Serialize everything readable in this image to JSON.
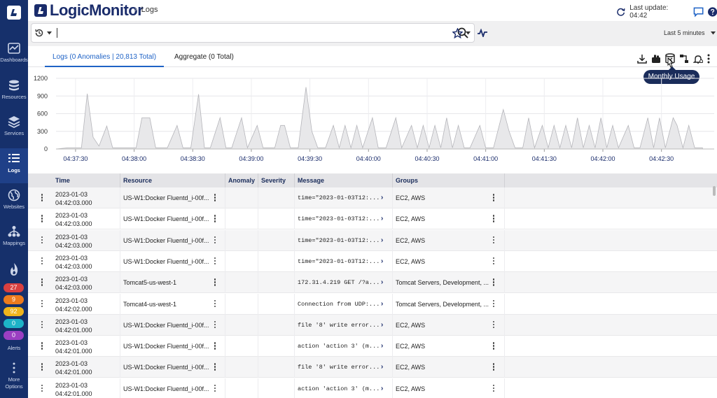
{
  "app": {
    "brand": "LogicMonitor",
    "breadcrumb": "Logs",
    "last_update": "Last update: 04:42"
  },
  "nav": [
    {
      "label": "Dashboards",
      "icon": "dashboards-icon"
    },
    {
      "label": "Resources",
      "icon": "resources-icon"
    },
    {
      "label": "Services",
      "icon": "services-icon"
    },
    {
      "label": "Logs",
      "icon": "logs-icon"
    },
    {
      "label": "Websites",
      "icon": "websites-icon"
    },
    {
      "label": "Mappings",
      "icon": "mappings-icon"
    }
  ],
  "alerts": {
    "label": "Alerts",
    "counts": [
      {
        "value": "27",
        "color": "#d93f3f"
      },
      {
        "value": "9",
        "color": "#ee7b1d"
      },
      {
        "value": "92",
        "color": "#f0b41c"
      },
      {
        "value": "0",
        "color": "#1db3c8"
      },
      {
        "value": "0",
        "color": "#9b3fc2"
      }
    ]
  },
  "more_options": {
    "line1": "More",
    "line2": "Options"
  },
  "search": {
    "value": "",
    "time_range": "Last 5 minutes"
  },
  "tabs": [
    {
      "label": "Logs (0 Anomalies | 20,813 Total)"
    },
    {
      "label": "Aggregate (0 Total)"
    }
  ],
  "tooltip": "Monthly Usage",
  "chart_data": {
    "type": "area",
    "title": "",
    "xlabel": "",
    "ylabel": "",
    "y_ticks": [
      0,
      300,
      600,
      900,
      1200
    ],
    "ylim": [
      0,
      1200
    ],
    "x_ticks": [
      "04:37:30",
      "04:38:00",
      "04:38:30",
      "04:39:00",
      "04:39:30",
      "04:40:00",
      "04:40:30",
      "04:41:00",
      "04:41:30",
      "04:42:00",
      "04:42:30"
    ],
    "x_range_seconds": [
      -10,
      327
    ],
    "grid": true,
    "points": [
      [
        -10,
        0
      ],
      [
        -4,
        20
      ],
      [
        3,
        20
      ],
      [
        6,
        940
      ],
      [
        9,
        200
      ],
      [
        12,
        50
      ],
      [
        16,
        390
      ],
      [
        19,
        20
      ],
      [
        26,
        20
      ],
      [
        31,
        20
      ],
      [
        34,
        530
      ],
      [
        38,
        530
      ],
      [
        41,
        20
      ],
      [
        47,
        20
      ],
      [
        52,
        400
      ],
      [
        55,
        20
      ],
      [
        59,
        20
      ],
      [
        63,
        930
      ],
      [
        66,
        20
      ],
      [
        69,
        20
      ],
      [
        74,
        530
      ],
      [
        77,
        20
      ],
      [
        80,
        20
      ],
      [
        85,
        530
      ],
      [
        88,
        20
      ],
      [
        93,
        400
      ],
      [
        96,
        20
      ],
      [
        102,
        20
      ],
      [
        105,
        400
      ],
      [
        107,
        400
      ],
      [
        110,
        20
      ],
      [
        114,
        20
      ],
      [
        118,
        1050
      ],
      [
        121,
        300
      ],
      [
        124,
        20
      ],
      [
        128,
        20
      ],
      [
        132,
        400
      ],
      [
        135,
        20
      ],
      [
        138,
        400
      ],
      [
        141,
        20
      ],
      [
        144,
        400
      ],
      [
        147,
        20
      ],
      [
        152,
        530
      ],
      [
        155,
        20
      ],
      [
        159,
        20
      ],
      [
        164,
        530
      ],
      [
        167,
        20
      ],
      [
        172,
        400
      ],
      [
        175,
        20
      ],
      [
        178,
        400
      ],
      [
        181,
        20
      ],
      [
        184,
        400
      ],
      [
        187,
        20
      ],
      [
        190,
        530
      ],
      [
        193,
        20
      ],
      [
        196,
        400
      ],
      [
        199,
        20
      ],
      [
        202,
        20
      ],
      [
        207,
        400
      ],
      [
        210,
        20
      ],
      [
        214,
        20
      ],
      [
        219,
        670
      ],
      [
        222,
        300
      ],
      [
        225,
        20
      ],
      [
        229,
        20
      ],
      [
        232,
        530
      ],
      [
        235,
        20
      ],
      [
        239,
        400
      ],
      [
        242,
        20
      ],
      [
        245,
        400
      ],
      [
        248,
        20
      ],
      [
        251,
        400
      ],
      [
        254,
        20
      ],
      [
        257,
        530
      ],
      [
        260,
        20
      ],
      [
        263,
        400
      ],
      [
        266,
        20
      ],
      [
        269,
        530
      ],
      [
        272,
        20
      ],
      [
        275,
        400
      ],
      [
        278,
        20
      ],
      [
        283,
        400
      ],
      [
        286,
        20
      ],
      [
        289,
        20
      ],
      [
        293,
        530
      ],
      [
        296,
        20
      ],
      [
        299,
        530
      ],
      [
        302,
        20
      ],
      [
        306,
        530
      ],
      [
        308,
        400
      ],
      [
        311,
        20
      ],
      [
        314,
        400
      ],
      [
        317,
        20
      ],
      [
        321,
        20
      ]
    ]
  },
  "table": {
    "columns": [
      "Time",
      "Resource",
      "Anomaly",
      "Severity",
      "Message",
      "Groups"
    ],
    "rows": [
      {
        "date": "2023-01-03",
        "time": "04:42:03.000",
        "resource": "US-W1:Docker Fluentd_i-00f...",
        "message": "time=\"2023-01-03T12:...",
        "groups": "EC2, AWS"
      },
      {
        "date": "2023-01-03",
        "time": "04:42:03.000",
        "resource": "US-W1:Docker Fluentd_i-00f...",
        "message": "time=\"2023-01-03T12:...",
        "groups": "EC2, AWS"
      },
      {
        "date": "2023-01-03",
        "time": "04:42:03.000",
        "resource": "US-W1:Docker Fluentd_i-00f...",
        "message": "time=\"2023-01-03T12:...",
        "groups": "EC2, AWS"
      },
      {
        "date": "2023-01-03",
        "time": "04:42:03.000",
        "resource": "US-W1:Docker Fluentd_i-00f...",
        "message": "time=\"2023-01-03T12:...",
        "groups": "EC2, AWS"
      },
      {
        "date": "2023-01-03",
        "time": "04:42:03.000",
        "resource": "Tomcat5-us-west-1",
        "message": "172.31.4.219 GET /?a...",
        "groups": "Tomcat Servers, Development, ..."
      },
      {
        "date": "2023-01-03",
        "time": "04:42:02.000",
        "resource": "Tomcat4-us-west-1",
        "message": "Connection from UDP:...",
        "groups": "Tomcat Servers, Development, ..."
      },
      {
        "date": "2023-01-03",
        "time": "04:42:01.000",
        "resource": "US-W1:Docker Fluentd_i-00f...",
        "message": "file '8' write error...",
        "groups": "EC2, AWS"
      },
      {
        "date": "2023-01-03",
        "time": "04:42:01.000",
        "resource": "US-W1:Docker Fluentd_i-00f...",
        "message": "action 'action 3' (m...",
        "groups": "EC2, AWS"
      },
      {
        "date": "2023-01-03",
        "time": "04:42:01.000",
        "resource": "US-W1:Docker Fluentd_i-00f...",
        "message": "file '8' write error...",
        "groups": "EC2, AWS"
      },
      {
        "date": "2023-01-03",
        "time": "04:42:01.000",
        "resource": "US-W1:Docker Fluentd_i-00f...",
        "message": "action 'action 3' (m...",
        "groups": "EC2, AWS"
      }
    ]
  }
}
